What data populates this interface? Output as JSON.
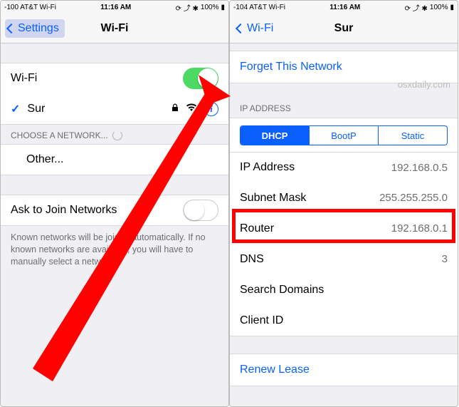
{
  "left": {
    "status": {
      "carrier": "-100 AT&T Wi-Fi",
      "time": "11:16 AM",
      "battery": "100%"
    },
    "nav": {
      "back": "Settings",
      "title": "Wi-Fi"
    },
    "wifi_toggle_label": "Wi-Fi",
    "connected_network": "Sur",
    "choose_header": "CHOOSE A NETWORK...",
    "other": "Other...",
    "ask_join": "Ask to Join Networks",
    "footer": "Known networks will be joined automatically. If no known networks are available, you will have to manually select a network."
  },
  "right": {
    "status": {
      "carrier": "-104 AT&T Wi-Fi",
      "time": "11:16 AM",
      "battery": "100%"
    },
    "nav": {
      "back": "Wi-Fi",
      "title": "Sur"
    },
    "forget": "Forget This Network",
    "ip_header": "IP ADDRESS",
    "watermark": "osxdaily.com",
    "seg": {
      "dhcp": "DHCP",
      "bootp": "BootP",
      "static": "Static"
    },
    "rows": {
      "ip_label": "IP Address",
      "ip_val": "192.168.0.5",
      "subnet_label": "Subnet Mask",
      "subnet_val": "255.255.255.0",
      "router_label": "Router",
      "router_val": "192.168.0.1",
      "dns_label": "DNS",
      "dns_val": "3",
      "search_label": "Search Domains",
      "search_val": "",
      "client_label": "Client ID",
      "client_val": ""
    },
    "renew": "Renew Lease"
  }
}
